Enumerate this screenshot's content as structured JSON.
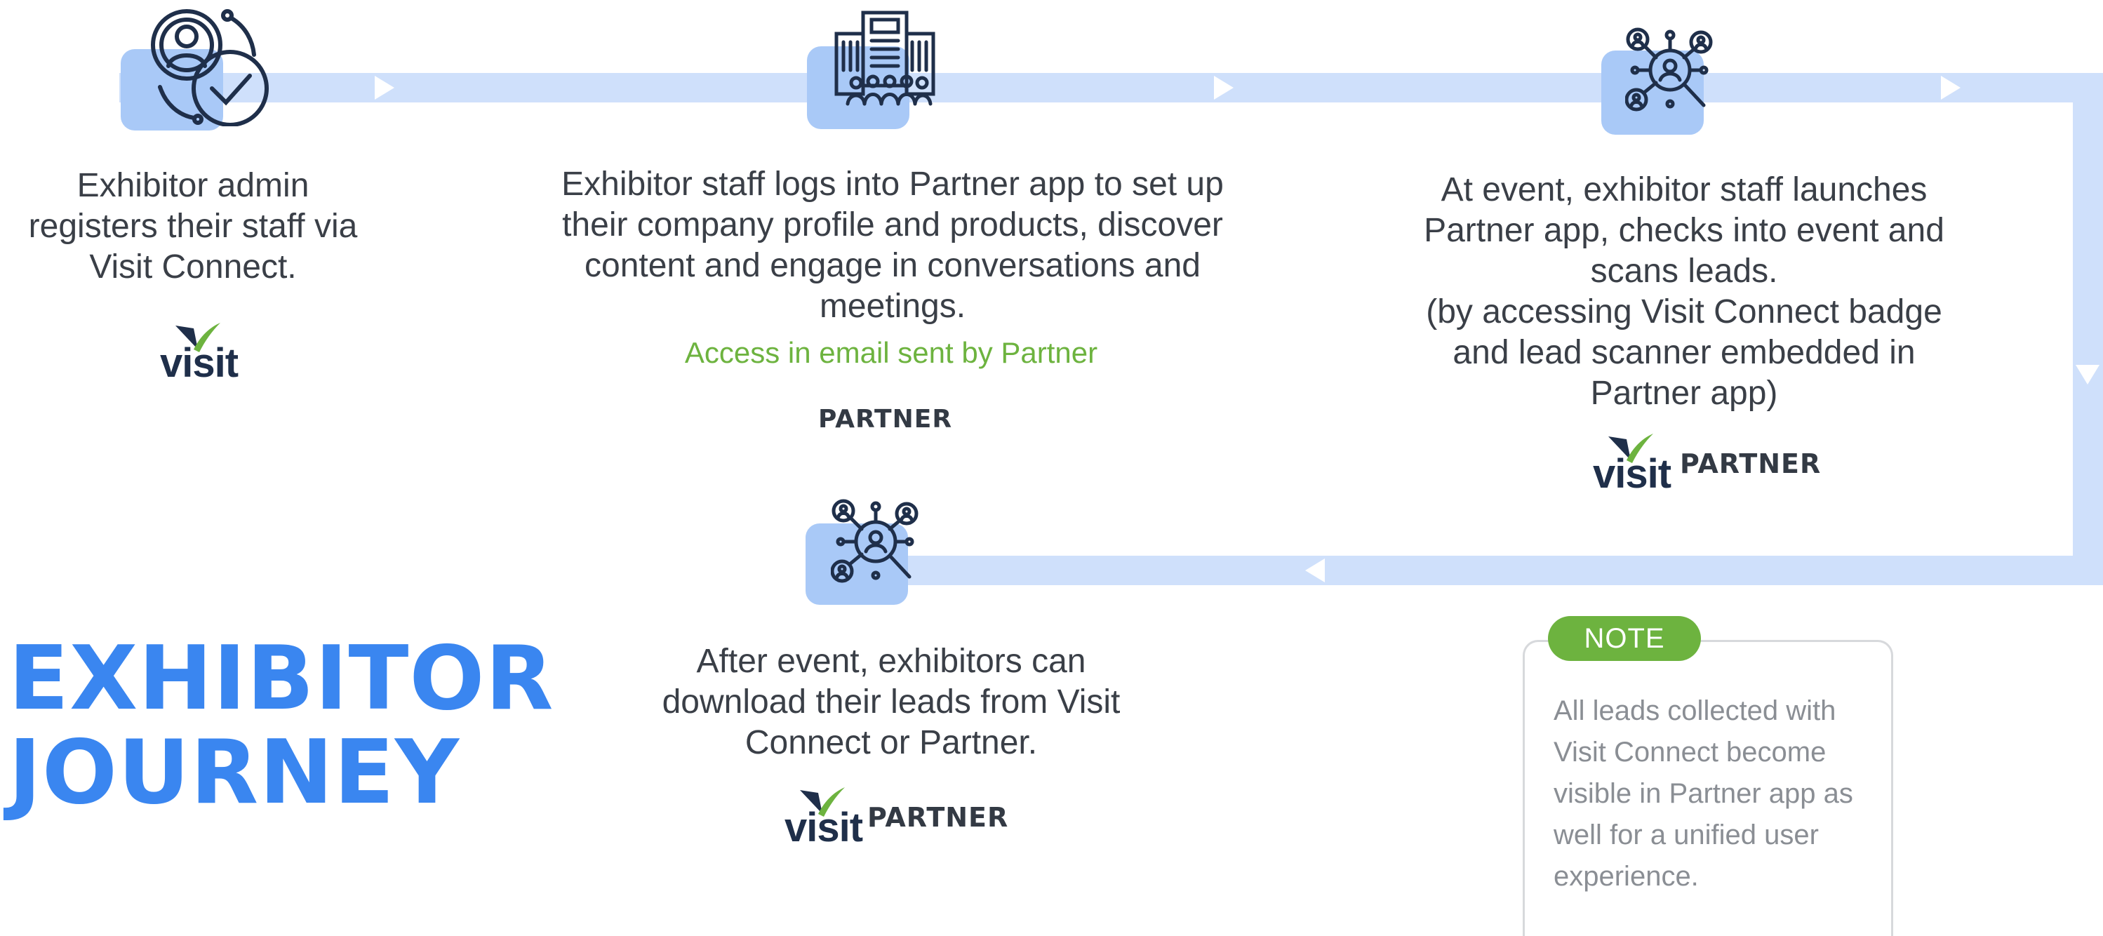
{
  "title": {
    "line1": "EXHIBITOR",
    "line2": "JOURNEY"
  },
  "colors": {
    "accent_blue": "#3a86f0",
    "flow_blue": "#cfe0fb",
    "icon_square": "#a9c9f7",
    "icon_ink": "#1f2f4a",
    "green": "#6db33f",
    "text": "#3a3f47",
    "note_text": "#8a8e94"
  },
  "steps": [
    {
      "icon": "admin-check-icon",
      "text": "Exhibitor admin\nregisters their staff via\nVisit Connect.",
      "logos": [
        "visit"
      ]
    },
    {
      "icon": "building-people-icon",
      "text": "Exhibitor staff logs into Partner app to set up\ntheir company profile and products, discover\ncontent and engage in conversations and\nmeetings.",
      "subtext": "Access in email sent by Partner",
      "logos": [
        "partner"
      ]
    },
    {
      "icon": "lead-search-icon",
      "text": "At event, exhibitor staff launches\nPartner app, checks into event and\nscans leads.\n(by accessing Visit Connect badge\nand lead scanner embedded in\nPartner app)",
      "logos": [
        "visit",
        "partner"
      ]
    },
    {
      "icon": "lead-search-icon",
      "text": "After event, exhibitors can\ndownload their leads from Visit\nConnect or Partner.",
      "logos": [
        "visit",
        "partner"
      ]
    }
  ],
  "logos": {
    "visit": "visit",
    "partner": "PARTNER"
  },
  "note": {
    "badge": "NOTE",
    "text": "All leads collected with Visit Connect become visible in Partner app as well for a unified user experience."
  }
}
